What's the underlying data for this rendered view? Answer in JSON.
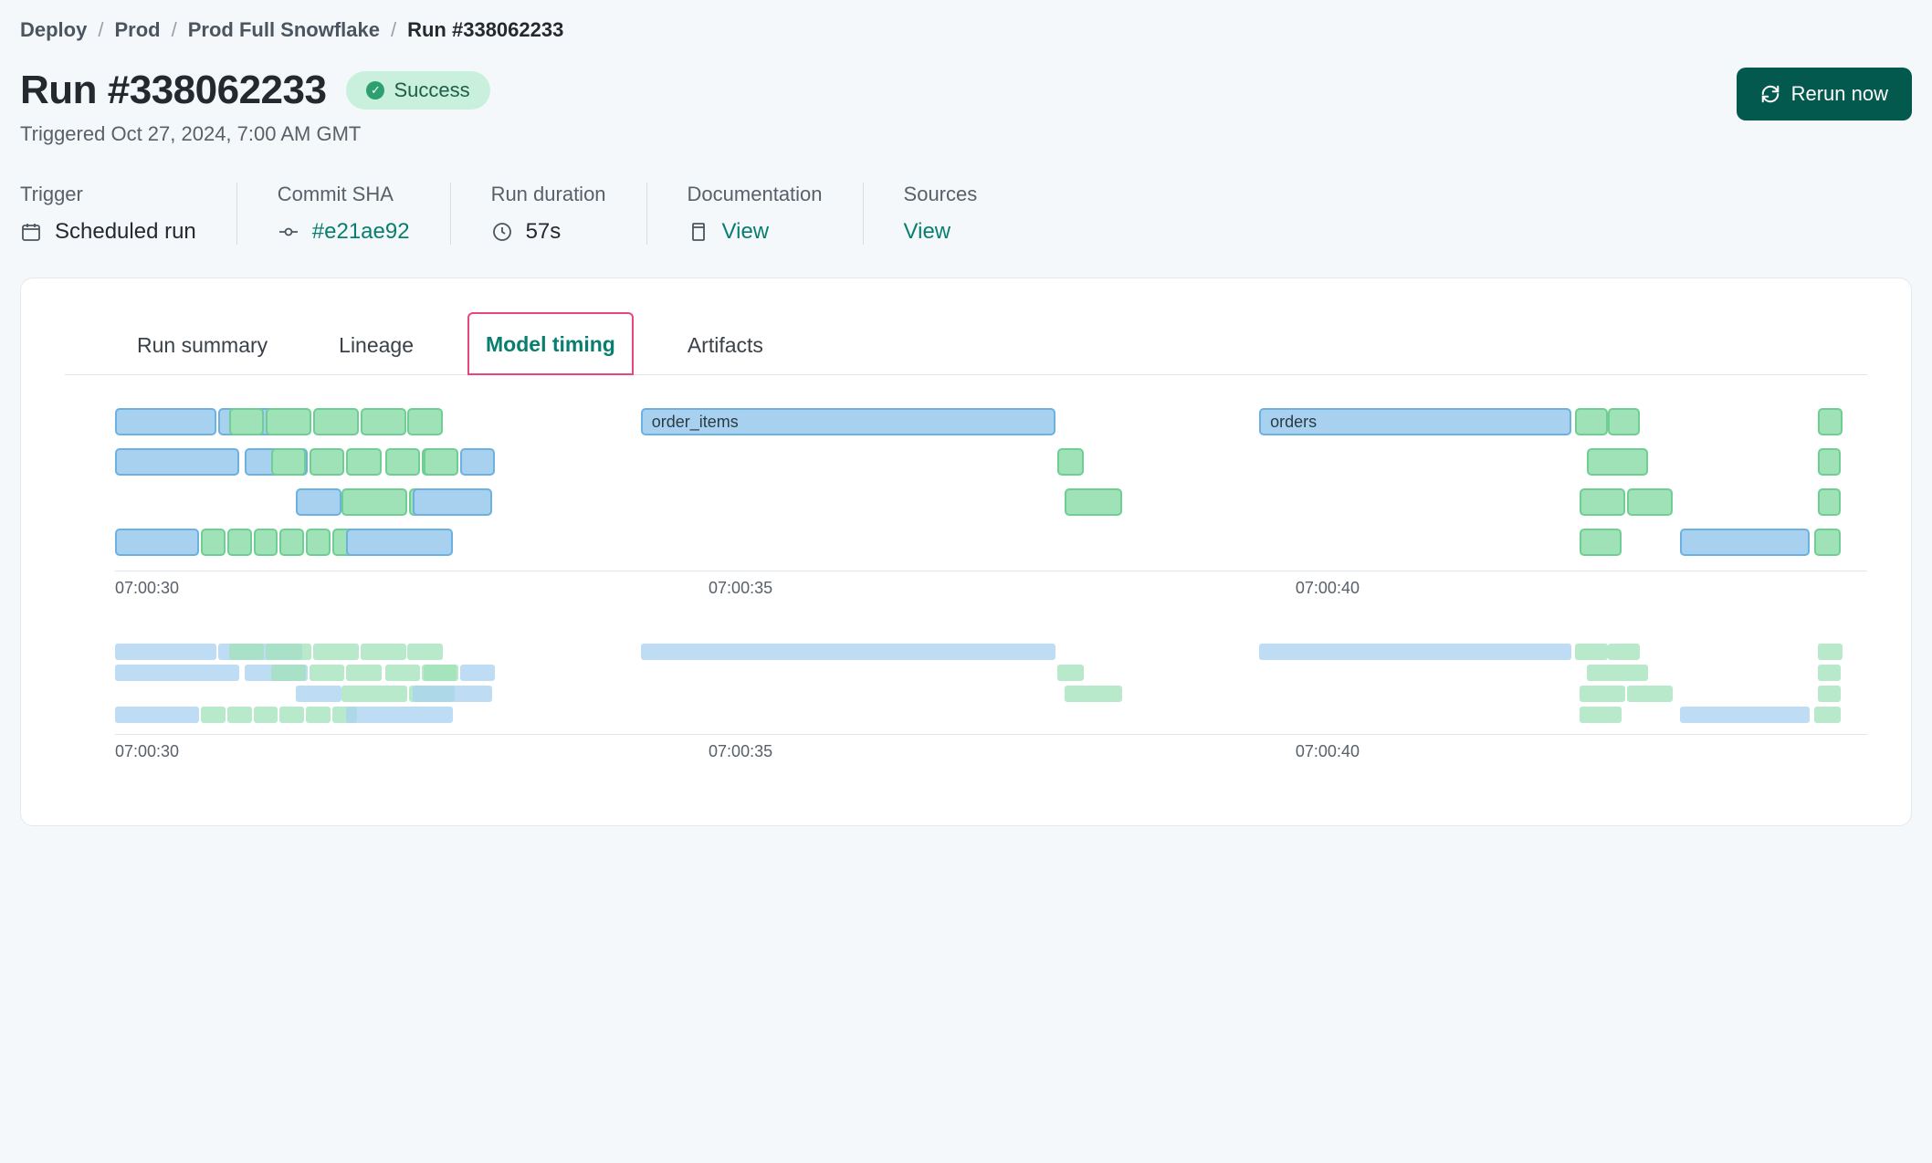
{
  "breadcrumb": {
    "items": [
      "Deploy",
      "Prod",
      "Prod Full Snowflake",
      "Run #338062233"
    ]
  },
  "header": {
    "title": "Run #338062233",
    "status": "Success",
    "subtitle": "Triggered Oct 27, 2024, 7:00 AM GMT",
    "rerun_label": "Rerun now"
  },
  "meta": {
    "trigger": {
      "label": "Trigger",
      "value": "Scheduled run"
    },
    "commit": {
      "label": "Commit SHA",
      "value": "#e21ae92"
    },
    "duration": {
      "label": "Run duration",
      "value": "57s"
    },
    "documentation": {
      "label": "Documentation",
      "value": "View"
    },
    "sources": {
      "label": "Sources",
      "value": "View"
    }
  },
  "tabs": {
    "items": [
      "Run summary",
      "Lineage",
      "Model timing",
      "Artifacts"
    ],
    "active_index": 2
  },
  "chart_data": {
    "type": "gantt",
    "x_axis": {
      "ticks": [
        "07:00:30",
        "07:00:35",
        "07:00:40"
      ],
      "range_start": "07:00:29",
      "range_end": "07:00:44.8"
    },
    "rows": [
      {
        "bars": [
          {
            "start": 0.0,
            "width": 5.8,
            "color": "blue"
          },
          {
            "start": 5.9,
            "width": 4.8,
            "color": "blue"
          },
          {
            "start": 6.5,
            "width": 2.0,
            "color": "green"
          },
          {
            "start": 8.6,
            "width": 2.6,
            "color": "green"
          },
          {
            "start": 11.3,
            "width": 2.6,
            "color": "green"
          },
          {
            "start": 14.0,
            "width": 2.6,
            "color": "green"
          },
          {
            "start": 16.7,
            "width": 2.0,
            "color": "green"
          },
          {
            "start": 30.0,
            "width": 23.7,
            "color": "blue",
            "label": "order_items"
          },
          {
            "start": 65.3,
            "width": 17.8,
            "color": "blue",
            "label": "orders"
          },
          {
            "start": 83.3,
            "width": 1.9,
            "color": "green"
          },
          {
            "start": 85.2,
            "width": 1.8,
            "color": "green"
          },
          {
            "start": 97.2,
            "width": 1.4,
            "color": "green"
          }
        ]
      },
      {
        "bars": [
          {
            "start": 0.0,
            "width": 7.1,
            "color": "blue"
          },
          {
            "start": 7.4,
            "width": 3.6,
            "color": "blue"
          },
          {
            "start": 8.9,
            "width": 2.0,
            "color": "green"
          },
          {
            "start": 11.1,
            "width": 2.0,
            "color": "green"
          },
          {
            "start": 13.2,
            "width": 2.0,
            "color": "green"
          },
          {
            "start": 15.4,
            "width": 2.0,
            "color": "green"
          },
          {
            "start": 17.5,
            "width": 2.0,
            "color": "green"
          },
          {
            "start": 17.6,
            "width": 2.0,
            "color": "green"
          },
          {
            "start": 19.7,
            "width": 2.0,
            "color": "blue"
          },
          {
            "start": 53.8,
            "width": 1.5,
            "color": "green"
          },
          {
            "start": 84.0,
            "width": 3.5,
            "color": "green"
          },
          {
            "start": 97.2,
            "width": 1.3,
            "color": "green"
          }
        ]
      },
      {
        "bars": [
          {
            "start": 10.3,
            "width": 2.6,
            "color": "blue"
          },
          {
            "start": 12.9,
            "width": 3.8,
            "color": "green"
          },
          {
            "start": 16.8,
            "width": 2.6,
            "color": "green"
          },
          {
            "start": 17.0,
            "width": 4.5,
            "color": "blue"
          },
          {
            "start": 54.2,
            "width": 3.3,
            "color": "green"
          },
          {
            "start": 83.6,
            "width": 2.6,
            "color": "green"
          },
          {
            "start": 86.3,
            "width": 2.6,
            "color": "green"
          },
          {
            "start": 97.2,
            "width": 1.3,
            "color": "green"
          }
        ]
      },
      {
        "bars": [
          {
            "start": 0.0,
            "width": 4.8,
            "color": "blue"
          },
          {
            "start": 4.9,
            "width": 1.4,
            "color": "green"
          },
          {
            "start": 6.4,
            "width": 1.4,
            "color": "green"
          },
          {
            "start": 7.9,
            "width": 1.4,
            "color": "green"
          },
          {
            "start": 9.4,
            "width": 1.4,
            "color": "green"
          },
          {
            "start": 10.9,
            "width": 1.4,
            "color": "green"
          },
          {
            "start": 12.4,
            "width": 1.4,
            "color": "green"
          },
          {
            "start": 13.2,
            "width": 6.1,
            "color": "blue"
          },
          {
            "start": 83.6,
            "width": 2.4,
            "color": "green"
          },
          {
            "start": 89.3,
            "width": 7.4,
            "color": "blue"
          },
          {
            "start": 97.0,
            "width": 1.5,
            "color": "green"
          }
        ]
      }
    ]
  },
  "minimap": {
    "x_axis": {
      "ticks": [
        "07:00:30",
        "07:00:35",
        "07:00:40"
      ]
    }
  }
}
